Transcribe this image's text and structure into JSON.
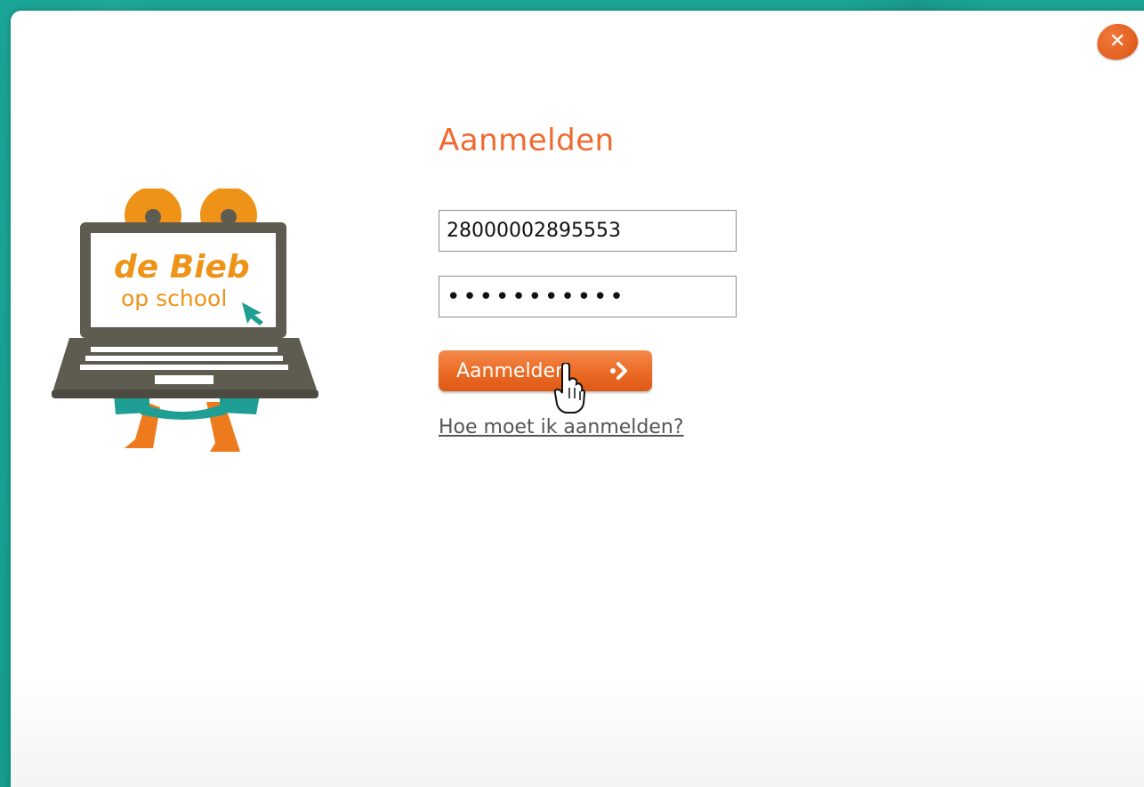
{
  "form": {
    "title": "Aanmelden",
    "username_value": "28000002895553",
    "password_value": "•••••••••••",
    "login_button_label": "Aanmelden",
    "help_link": "Hoe moet ik aanmelden?"
  },
  "logo": {
    "line1": "de Bieb",
    "line2": "op school"
  },
  "close_button": {
    "label": "✕"
  },
  "colors": {
    "accent_orange": "#ee6a2f",
    "background_teal": "#1aa597",
    "logo_dark": "#5e5b50",
    "logo_teal": "#1f9e94"
  }
}
